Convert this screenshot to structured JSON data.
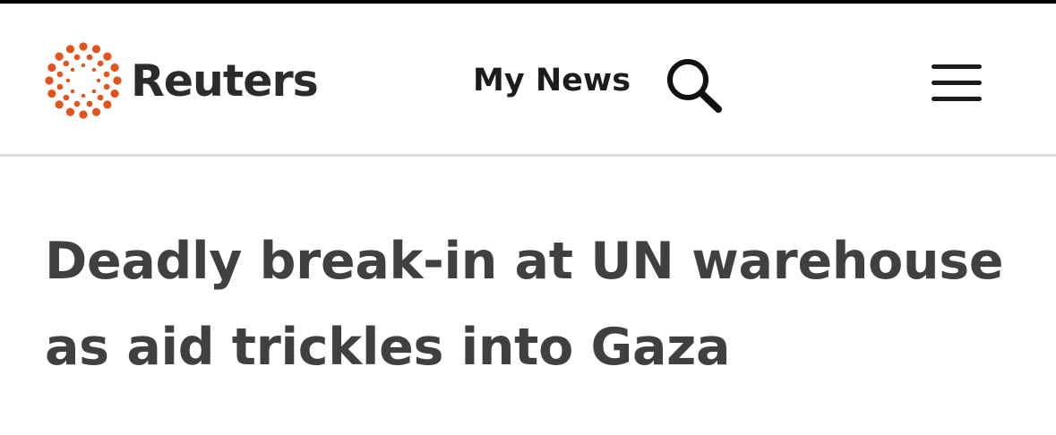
{
  "header": {
    "brand": "Reuters",
    "logo_icon": "reuters-dot-ring-logo",
    "my_news_label": "My News",
    "search_icon": "search-icon",
    "menu_icon": "hamburger-menu-icon"
  },
  "article": {
    "headline": "Deadly break-in at UN warehouse as aid trickles into Gaza"
  },
  "colors": {
    "brand_orange": "#e2541b",
    "text_dark": "#2b2b2b",
    "headline_text": "#404040",
    "divider": "#d9d9d9",
    "top_bar": "#000000"
  }
}
